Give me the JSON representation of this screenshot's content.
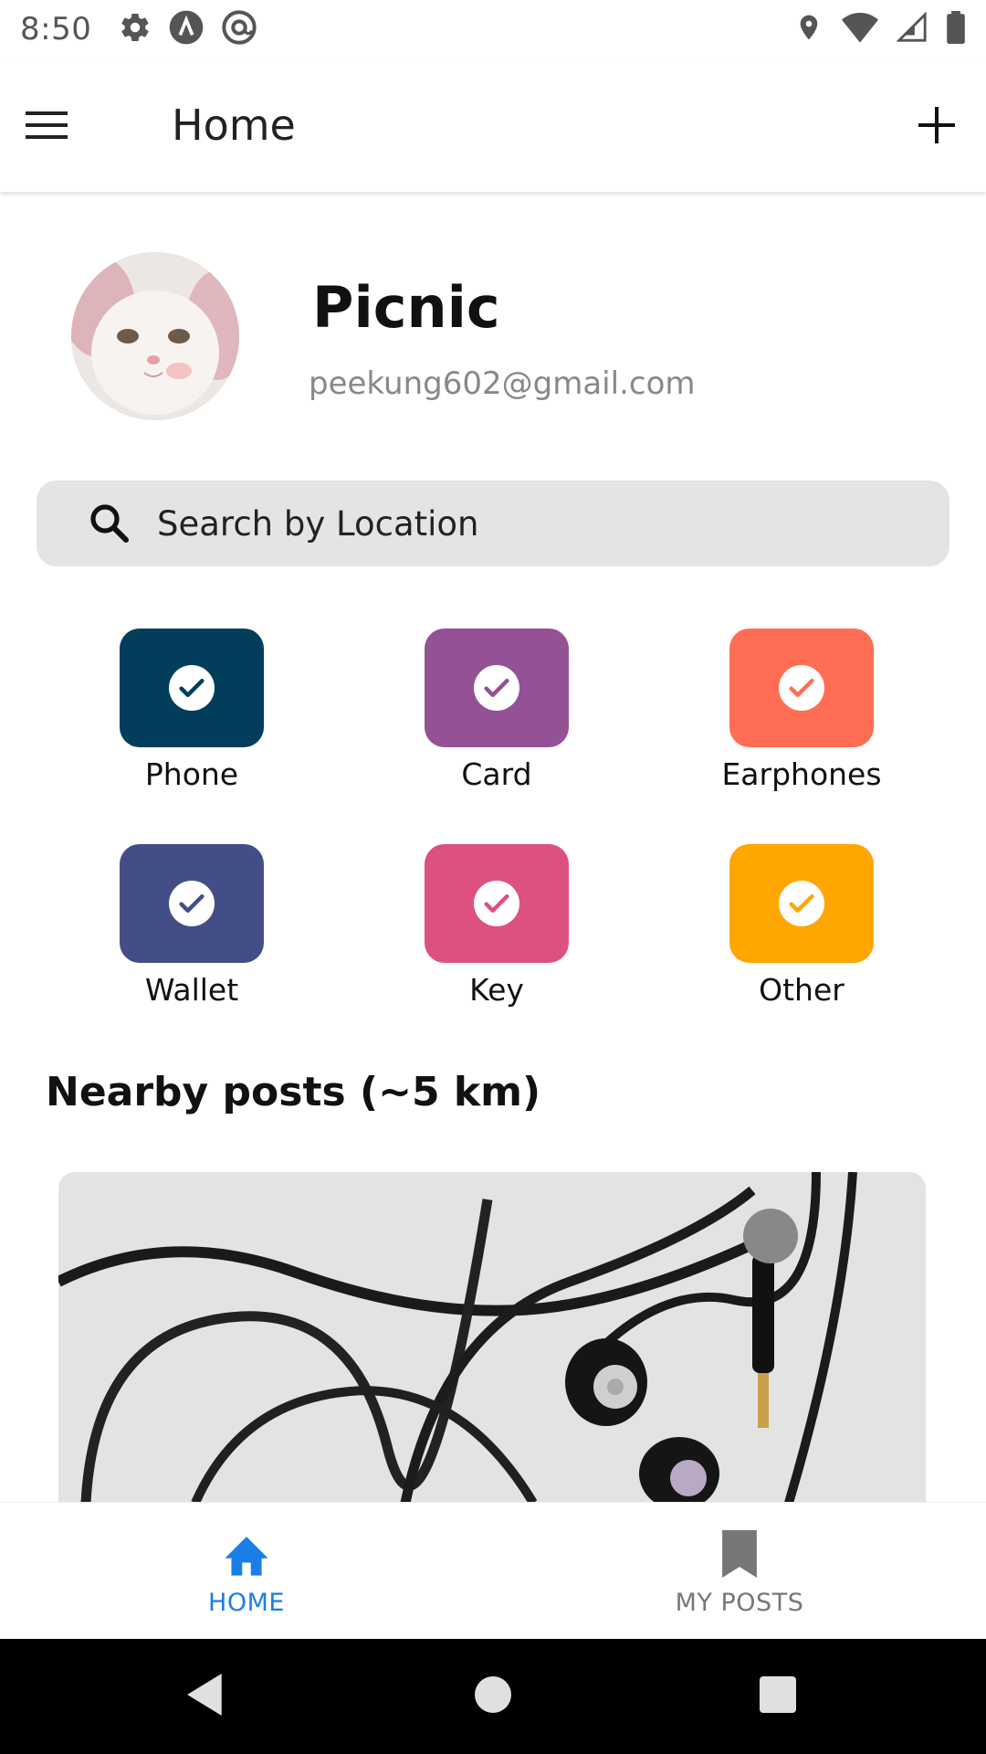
{
  "status_bar": {
    "time": "8:50",
    "icons_left": [
      "settings-icon",
      "a-circle-icon",
      "at-sign-icon"
    ],
    "icons_right": [
      "location-icon",
      "wifi-icon",
      "signal-icon",
      "battery-icon"
    ]
  },
  "app_bar": {
    "title": "Home",
    "menu_icon": "hamburger-menu-icon",
    "add_icon": "plus-icon"
  },
  "profile": {
    "name": "Picnic",
    "email": "peekung602@gmail.com"
  },
  "search": {
    "placeholder": "Search by Location"
  },
  "categories": [
    {
      "label": "Phone",
      "color": "#023D5C"
    },
    {
      "label": "Card",
      "color": "#955196"
    },
    {
      "label": "Earphones",
      "color": "#FF6E54"
    },
    {
      "label": "Wallet",
      "color": "#444E86"
    },
    {
      "label": "Key",
      "color": "#DD5182"
    },
    {
      "label": "Other",
      "color": "#FFA600"
    }
  ],
  "nearby": {
    "title": "Nearby posts (~5 km)"
  },
  "bottom_nav": {
    "items": [
      {
        "label": "HOME",
        "icon": "home-icon",
        "active": true
      },
      {
        "label": "MY POSTS",
        "icon": "bookmark-icon",
        "active": false
      }
    ],
    "active_color": "#1A7EE8",
    "inactive_color": "#777777"
  }
}
